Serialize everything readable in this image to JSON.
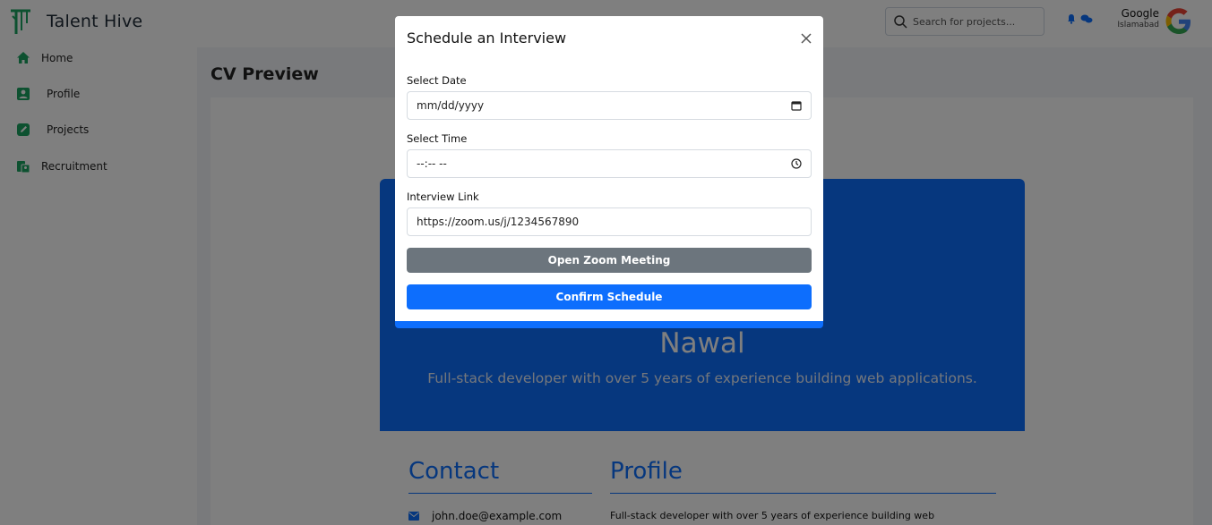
{
  "header": {
    "app_name": "Talent Hive",
    "search_placeholder": "Search for projects...",
    "company_name": "Google",
    "company_location": "Islamabad"
  },
  "sidebar": {
    "items": [
      {
        "label": "Home",
        "icon": "home-icon"
      },
      {
        "label": "Profile",
        "icon": "profile-icon"
      },
      {
        "label": "Projects",
        "icon": "edit-icon"
      },
      {
        "label": "Recruitment",
        "icon": "recruitment-icon"
      }
    ]
  },
  "main": {
    "page_title": "CV Preview",
    "cv": {
      "name": "Nawal",
      "summary": "Full-stack developer with over 5 years of experience building web applications.",
      "contact_title": "Contact",
      "profile_title": "Profile",
      "email": "john.doe@example.com",
      "profile_text": "Full-stack developer with over 5 years of experience building web"
    }
  },
  "modal": {
    "title": "Schedule an Interview",
    "date_label": "Select Date",
    "date_placeholder": "mm/dd/yyyy",
    "time_label": "Select Time",
    "time_placeholder": "--:-- --",
    "link_label": "Interview Link",
    "link_value": "https://zoom.us/j/1234567890",
    "zoom_button": "Open Zoom Meeting",
    "confirm_button": "Confirm Schedule"
  },
  "colors": {
    "primary": "#0d6efd",
    "secondary_button": "#6c757d",
    "sidebar_icon_green": "#1aa260"
  }
}
